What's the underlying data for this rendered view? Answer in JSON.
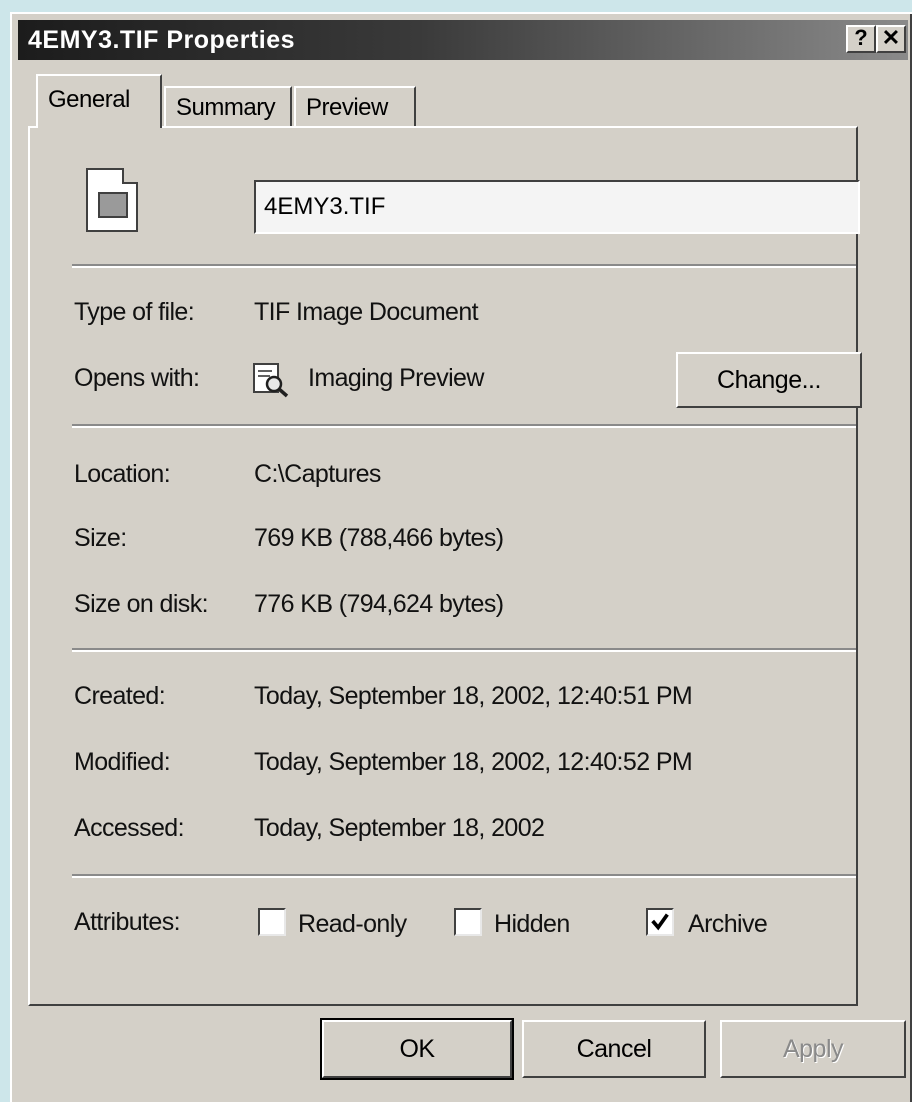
{
  "window": {
    "title": "4EMY3.TIF Properties",
    "help_label": "?",
    "close_label": "✕"
  },
  "tabs": [
    {
      "label": "General",
      "selected": true
    },
    {
      "label": "Summary",
      "selected": false
    },
    {
      "label": "Preview",
      "selected": false
    }
  ],
  "file": {
    "name": "4EMY3.TIF",
    "icon": "tif-file-icon"
  },
  "type_info": {
    "type_label": "Type of file:",
    "type_value": "TIF Image Document",
    "opens_label": "Opens with:",
    "opens_value": "Imaging Preview",
    "opens_icon": "imaging-preview-icon",
    "change_label": "Change..."
  },
  "location_info": {
    "location_label": "Location:",
    "location_value": "C:\\Captures",
    "size_label": "Size:",
    "size_value": "769 KB (788,466 bytes)",
    "size_disk_label": "Size on disk:",
    "size_disk_value": "776 KB (794,624 bytes)"
  },
  "dates": {
    "created_label": "Created:",
    "created_value": "Today, September 18, 2002, 12:40:51 PM",
    "modified_label": "Modified:",
    "modified_value": "Today, September 18, 2002, 12:40:52 PM",
    "accessed_label": "Accessed:",
    "accessed_value": "Today, September 18, 2002"
  },
  "attributes": {
    "label": "Attributes:",
    "read_only": {
      "label": "Read-only",
      "checked": false
    },
    "hidden": {
      "label": "Hidden",
      "checked": false
    },
    "archive": {
      "label": "Archive",
      "checked": true
    }
  },
  "footer": {
    "ok_label": "OK",
    "cancel_label": "Cancel",
    "apply_label": "Apply"
  }
}
